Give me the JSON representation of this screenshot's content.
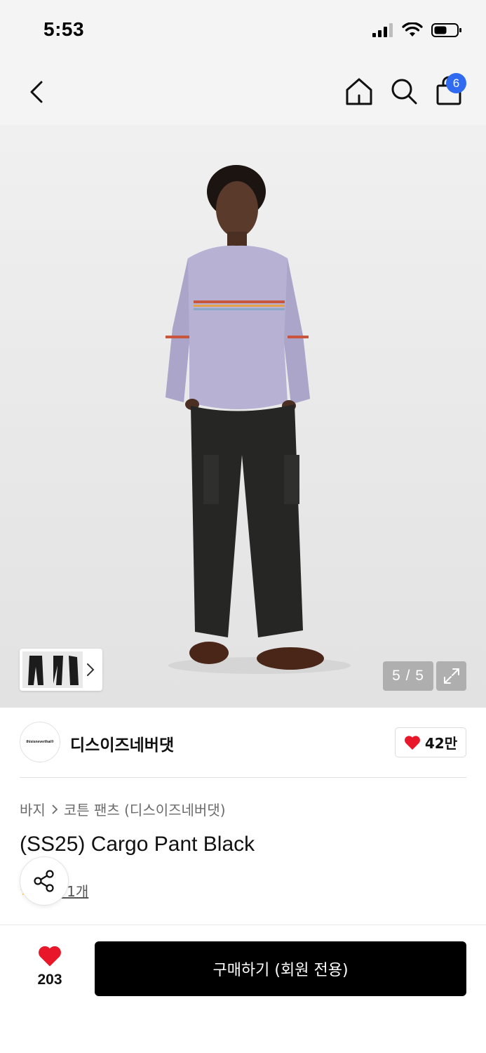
{
  "status_bar": {
    "time": "5:53",
    "icons": [
      "cellular-signal-icon",
      "wifi-icon",
      "battery-icon"
    ]
  },
  "nav": {
    "icons": [
      "back-chevron-icon",
      "home-icon",
      "search-icon",
      "shopping-bag-icon"
    ],
    "cart_count": "6",
    "badge_color": "#2f6af0"
  },
  "gallery": {
    "counter": "5 / 5",
    "thumb_icons": [
      "thumbnail-strip",
      "chevron-right-icon"
    ],
    "expand_icon": "expand-icon"
  },
  "brand": {
    "logo_text": "thisisneverthat®",
    "name": "디스이즈네버댓",
    "like_count": "42만"
  },
  "breadcrumb": {
    "category": "바지",
    "subcategory": "코튼 팬츠 (디스이즈네버댓)"
  },
  "product": {
    "title": "(SS25) Cargo Pant Black",
    "review_link": "후기 1개"
  },
  "bottom": {
    "like_count": "203",
    "buy_label": "구매하기 (회원 전용)",
    "accent_heart": "#e8182a"
  }
}
